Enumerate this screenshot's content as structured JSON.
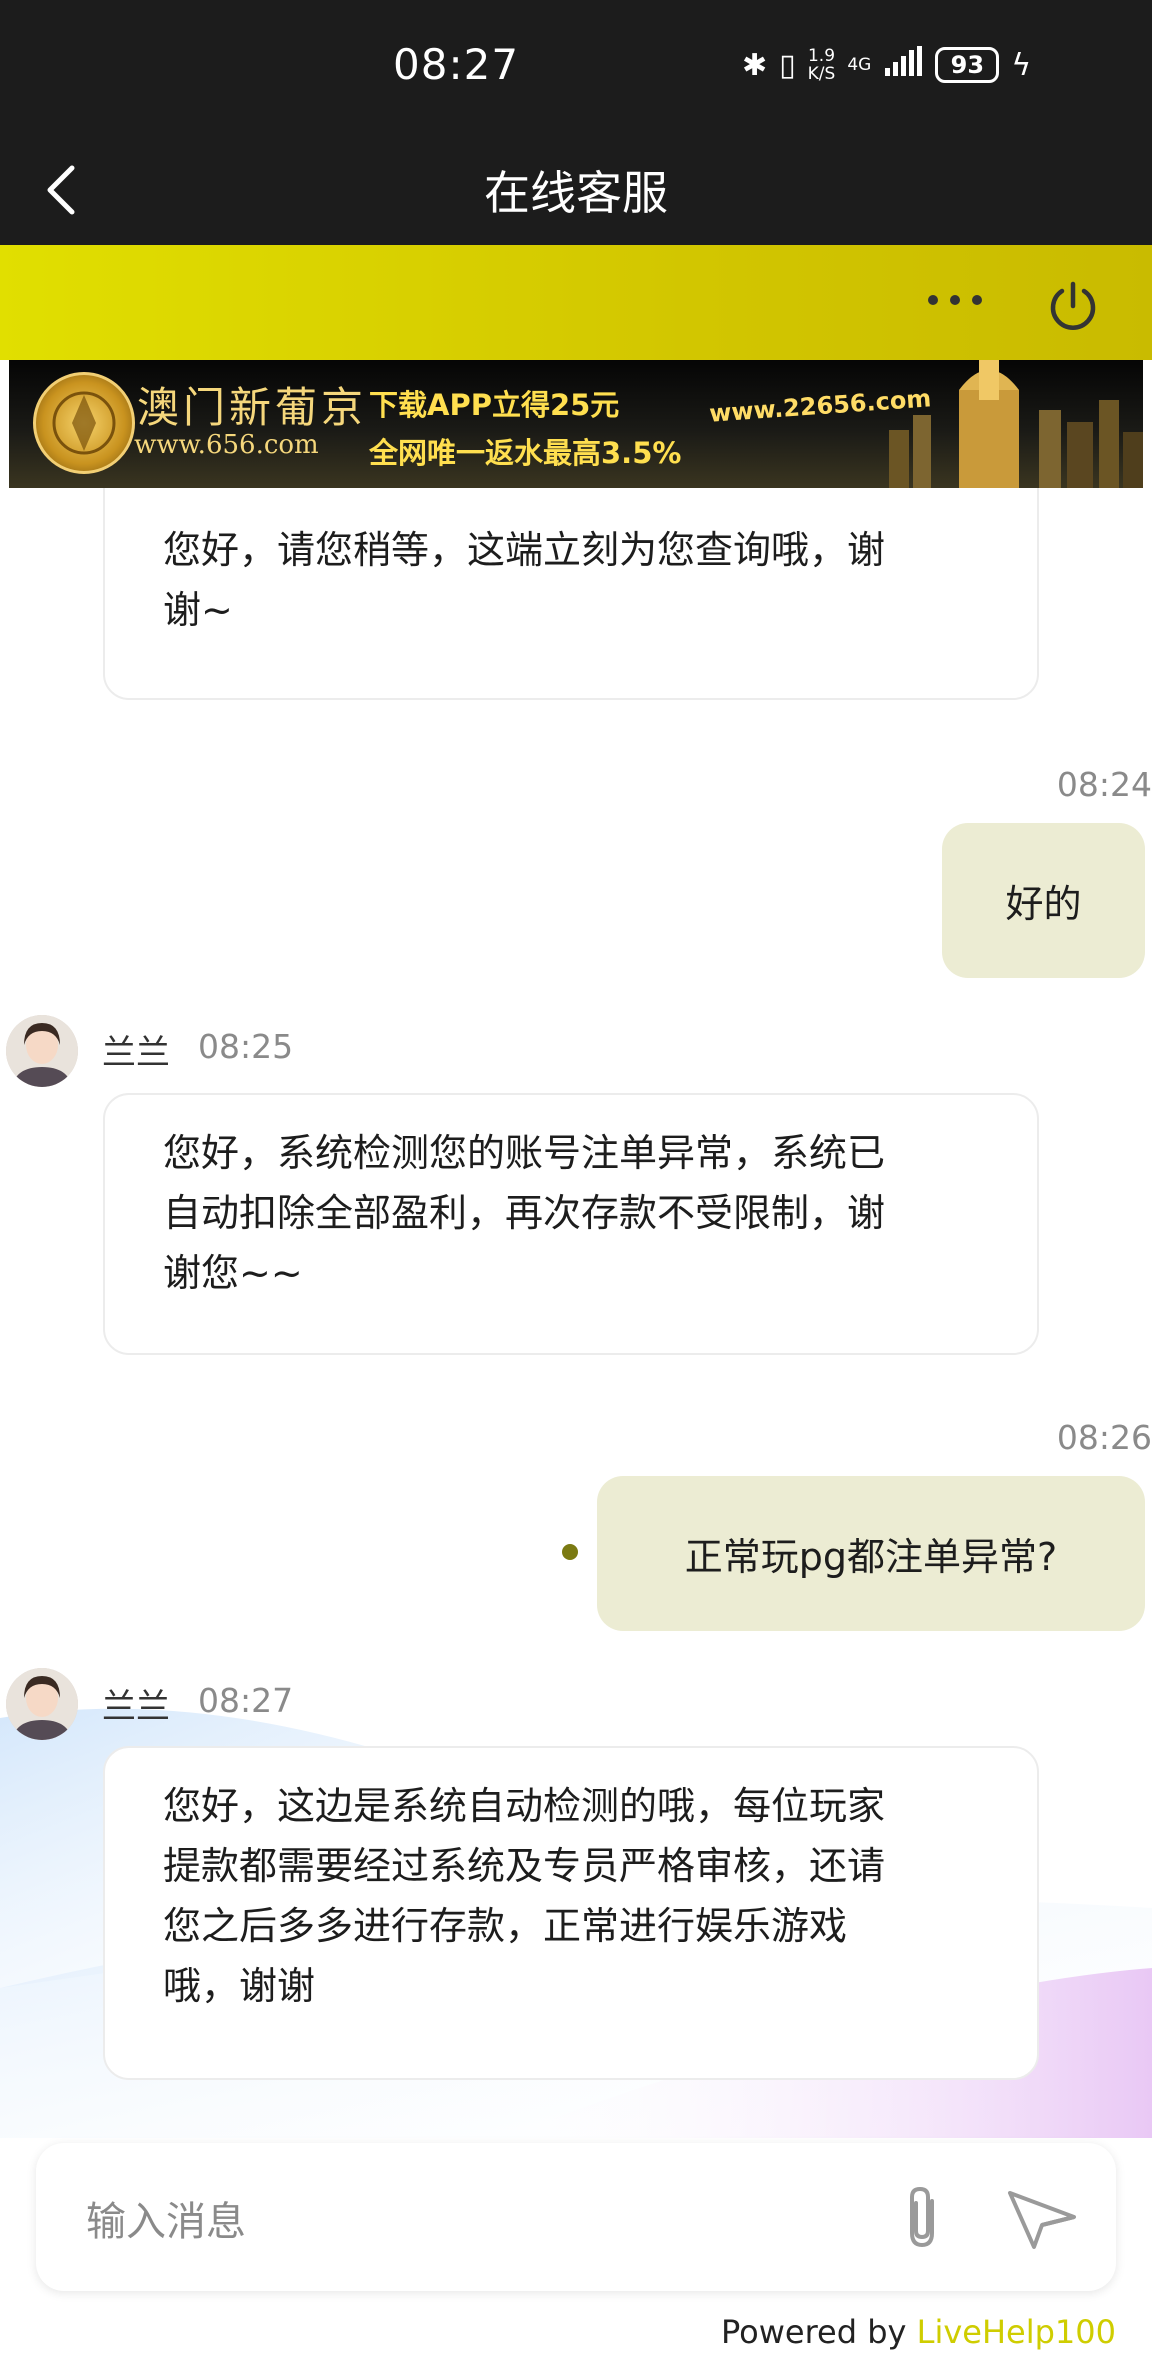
{
  "status_bar": {
    "time": "08:27",
    "net_speed_top": "1.9",
    "net_speed_bottom": "K/S",
    "network": "4G",
    "battery": "93"
  },
  "header": {
    "title": "在线客服"
  },
  "banner": {
    "brand": "澳门新葡京",
    "url": "www.656.com",
    "promo_line1": "下载APP立得25元",
    "promo_line2": "全网唯一返水最高3.5%",
    "site": "www.22656.com"
  },
  "messages": [
    {
      "side": "left",
      "text_lines": [
        "您好，请您稍等，这端立刻为您查询哦，谢",
        "谢~"
      ]
    },
    {
      "side": "right",
      "time": "08:24",
      "text": "好的"
    },
    {
      "side": "left",
      "name": "兰兰",
      "time": "08:25",
      "text_lines": [
        "您好，系统检测您的账号注单异常，系统已",
        "自动扣除全部盈利，再次存款不受限制，谢",
        "谢您~~"
      ]
    },
    {
      "side": "right",
      "time": "08:26",
      "text": "正常玩pg都注单异常?"
    },
    {
      "side": "left",
      "name": "兰兰",
      "time": "08:27",
      "text_lines": [
        "您好，这边是系统自动检测的哦，每位玩家",
        "提款都需要经过系统及专员严格审核，还请",
        "您之后多多进行存款，正常进行娱乐游戏",
        "哦，谢谢"
      ]
    }
  ],
  "input": {
    "placeholder": "输入消息"
  },
  "footer": {
    "prefix": "Powered by ",
    "brand": "LiveHelp100"
  },
  "colors": {
    "toolbar": "#d8d200",
    "user_bubble": "#ececd3",
    "brand": "#cfcd00"
  },
  "icons": [
    "back-arrow-icon",
    "more-dots-icon",
    "power-icon",
    "paperclip-icon",
    "send-icon"
  ]
}
